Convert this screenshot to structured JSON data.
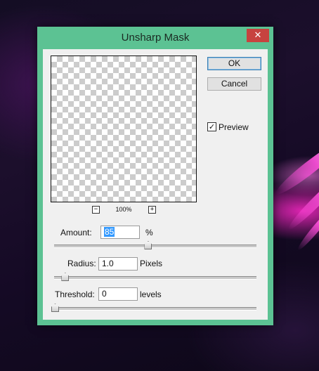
{
  "dialog": {
    "title": "Unsharp Mask",
    "close_glyph": "✕",
    "accent_color": "#5cc293"
  },
  "preview": {
    "zoom_out_glyph": "−",
    "zoom_in_glyph": "+",
    "zoom_level": "100%"
  },
  "buttons": {
    "ok": "OK",
    "cancel": "Cancel"
  },
  "preview_toggle": {
    "label": "Preview",
    "checked": true,
    "check_glyph": "✓"
  },
  "amount": {
    "label": "Amount:",
    "value": "85",
    "unit": "%",
    "slider_fraction": 0.46
  },
  "radius": {
    "label": "Radius:",
    "value": "1.0",
    "unit": "Pixels",
    "slider_fraction": 0.05
  },
  "threshold": {
    "label": "Threshold:",
    "value": "0",
    "unit": "levels",
    "slider_fraction": 0.0
  }
}
